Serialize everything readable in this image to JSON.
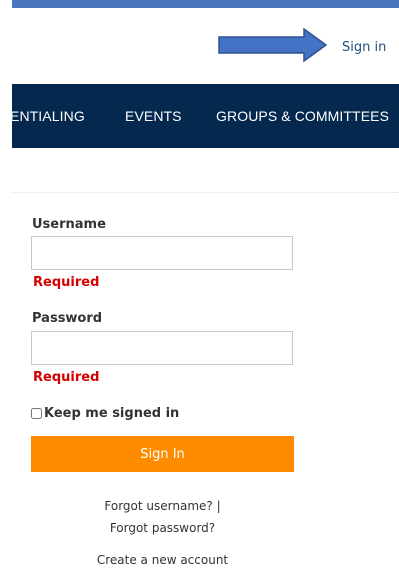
{
  "header": {
    "sign_in_label": "Sign in",
    "arrow_color": "#4472c4",
    "bar_color": "#4a76be"
  },
  "nav": {
    "items": [
      {
        "label": "ENTIALING"
      },
      {
        "label": "EVENTS"
      },
      {
        "label": "GROUPS & COMMITTEES"
      }
    ],
    "background": "#05284f"
  },
  "login": {
    "username_label": "Username",
    "username_value": "",
    "username_required": "Required",
    "password_label": "Password",
    "password_value": "",
    "password_required": "Required",
    "keep_signed_in_label": "Keep me signed in",
    "keep_signed_in_checked": false,
    "sign_in_button_label": "Sign In",
    "button_color": "#ff8b00",
    "error_color": "#d60000"
  },
  "links": {
    "forgot_username": "Forgot username? |",
    "forgot_password": "Forgot password?",
    "create_account": "Create a new account"
  }
}
